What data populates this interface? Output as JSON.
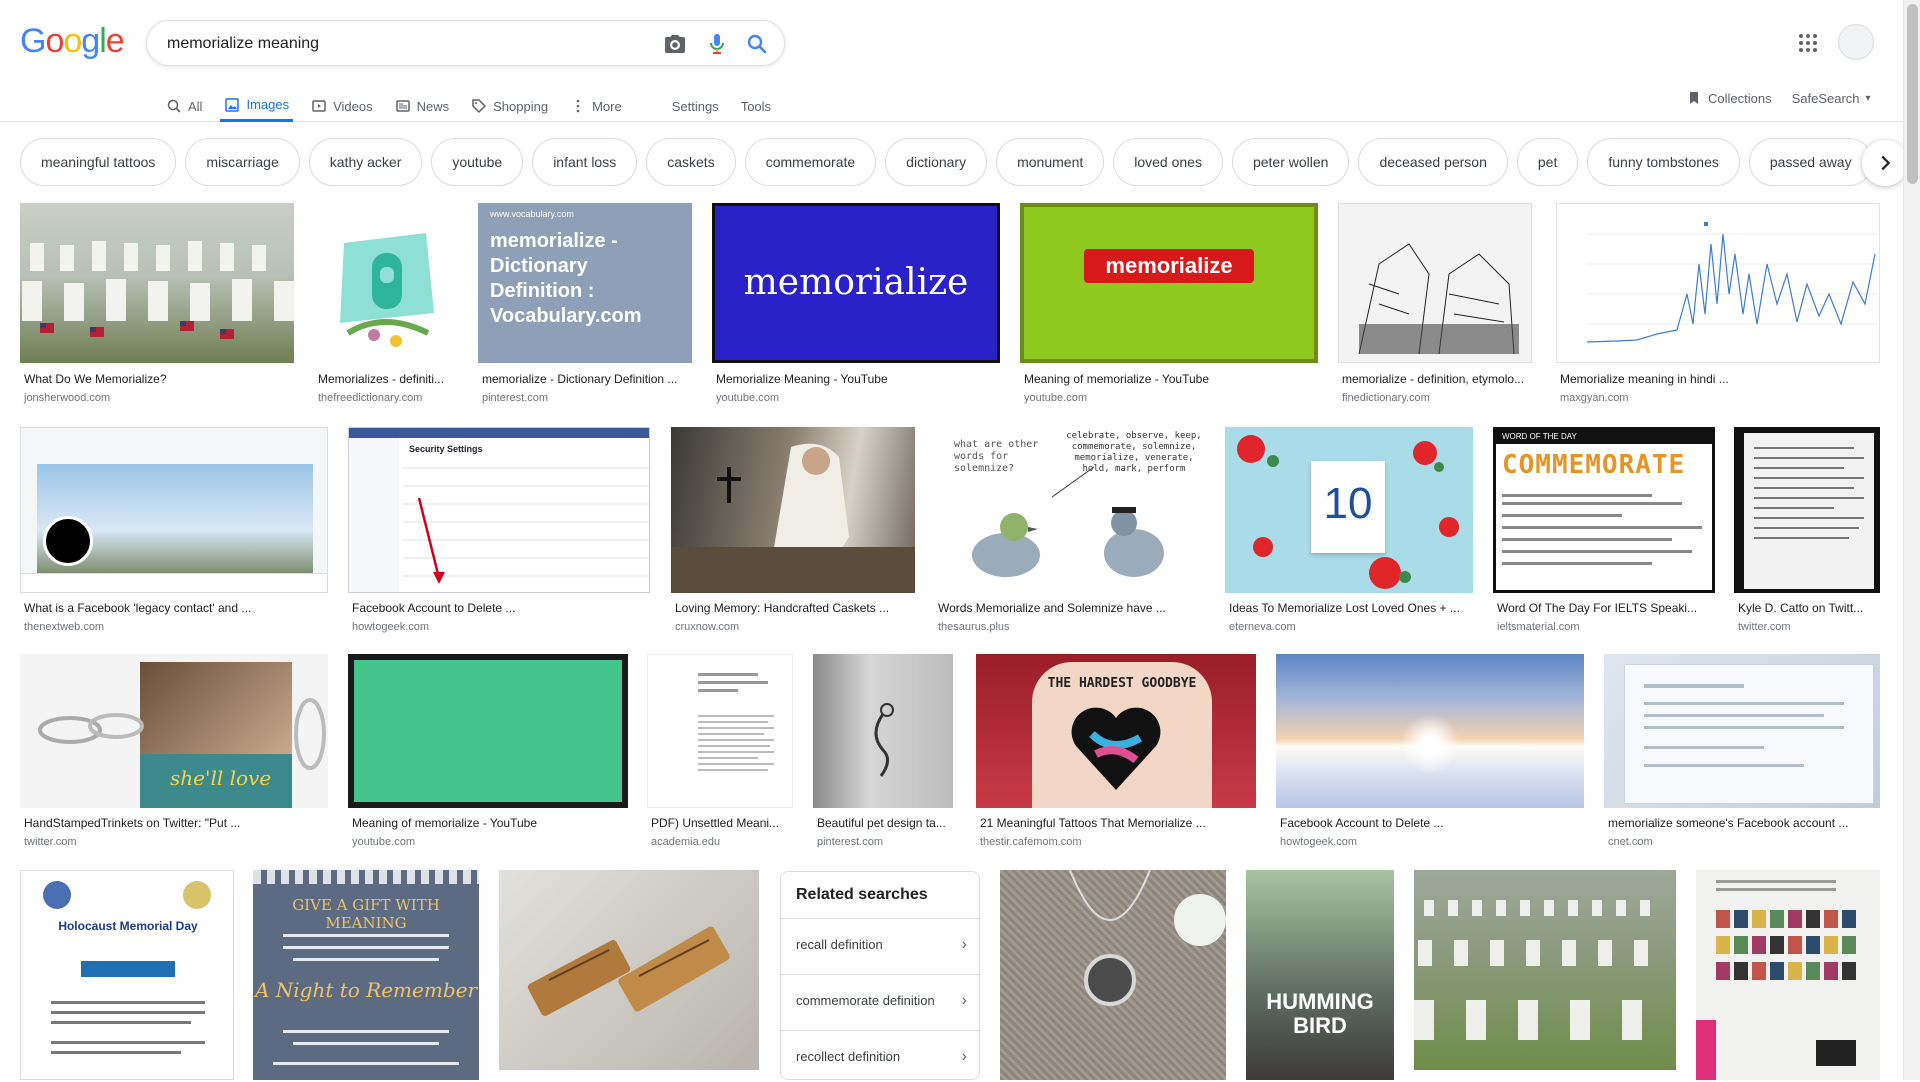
{
  "logo": "Google",
  "search": {
    "value": "memorialize meaning"
  },
  "tabs": [
    {
      "label": "All",
      "icon": "search-icon"
    },
    {
      "label": "Images",
      "icon": "image-icon",
      "active": true
    },
    {
      "label": "Videos",
      "icon": "video-icon"
    },
    {
      "label": "News",
      "icon": "news-icon"
    },
    {
      "label": "Shopping",
      "icon": "tag-icon"
    },
    {
      "label": "More",
      "icon": "more-vert-icon"
    },
    {
      "label": "Settings"
    },
    {
      "label": "Tools"
    }
  ],
  "right_tools": {
    "collections": "Collections",
    "safesearch": "SafeSearch"
  },
  "chips": [
    "meaningful tattoos",
    "miscarriage",
    "kathy acker",
    "youtube",
    "infant loss",
    "caskets",
    "commemorate",
    "dictionary",
    "monument",
    "loved ones",
    "peter wollen",
    "deceased person",
    "pet",
    "funny tombstones",
    "passed away"
  ],
  "results": {
    "row1": [
      {
        "title": "What Do We Memorialize?",
        "source": "jonsherwood.com"
      },
      {
        "title": "Memorializes - definiti...",
        "source": "thefreedictionary.com"
      },
      {
        "title": "memorialize - Dictionary Definition ...",
        "source": "pinterest.com",
        "image_text": "memorialize - Dictionary Definition : Vocabulary.com",
        "image_header": "www.vocabulary.com"
      },
      {
        "title": "Memorialize Meaning - YouTube",
        "source": "youtube.com",
        "image_text": "memorialize"
      },
      {
        "title": "Meaning of memorialize - YouTube",
        "source": "youtube.com",
        "image_text": "memorialize"
      },
      {
        "title": "memorialize - definition, etymolo...",
        "source": "finedictionary.com"
      },
      {
        "title": "Memorialize meaning in hindi ...",
        "source": "maxgyan.com"
      }
    ],
    "row2": [
      {
        "title": "What is a Facebook 'legacy contact' and ...",
        "source": "thenextweb.com"
      },
      {
        "title": "Facebook Account to Delete ...",
        "source": "howtogeek.com",
        "image_text": "Security Settings"
      },
      {
        "title": "Loving Memory: Handcrafted Caskets ...",
        "source": "cruxnow.com"
      },
      {
        "title": "Words Memorialize and Solemnize have ...",
        "source": "thesaurus.plus",
        "image_text": "what are other words for solemnize?",
        "image_text2": "celebrate, observe, keep, commemorate, solemnize, memorialize, venerate, hold, mark, perform"
      },
      {
        "title": "Ideas To Memorialize Lost Loved Ones + ...",
        "source": "eterneva.com",
        "image_text": "10"
      },
      {
        "title": "Word Of The Day For IELTS Speaki...",
        "source": "ieltsmaterial.com",
        "image_text": "COMMEMORATE",
        "image_header": "WORD OF THE DAY"
      },
      {
        "title": "Kyle D. Catto on Twitt...",
        "source": "twitter.com"
      }
    ],
    "row3": [
      {
        "title": "HandStampedTrinkets on Twitter: \"Put ...",
        "source": "twitter.com",
        "image_text": "she'll love"
      },
      {
        "title": "Meaning of memorialize - YouTube",
        "source": "youtube.com"
      },
      {
        "title": "PDF) Unsettled Meani...",
        "source": "academia.edu"
      },
      {
        "title": "Beautiful pet design ta...",
        "source": "pinterest.com"
      },
      {
        "title": "21 Meaningful Tattoos That Memorialize ...",
        "source": "thestir.cafemom.com",
        "image_text": "THE HARDEST GOODBYE"
      },
      {
        "title": "Facebook Account to Delete ...",
        "source": "howtogeek.com"
      },
      {
        "title": "memorialize someone's Facebook account ...",
        "source": "cnet.com"
      }
    ],
    "row4": [
      {
        "image_text": "Holocaust Memorial Day"
      },
      {
        "image_text": "GIVE A GIFT WITH MEANING",
        "image_text2": "A Night to Remember"
      },
      {},
      {},
      {
        "image_text": "HUMMING BIRD"
      },
      {},
      {}
    ]
  },
  "related": {
    "title": "Related searches",
    "items": [
      "recall definition",
      "commemorate definition",
      "recollect definition"
    ]
  },
  "colors": {
    "accent": "#1a73e8"
  }
}
